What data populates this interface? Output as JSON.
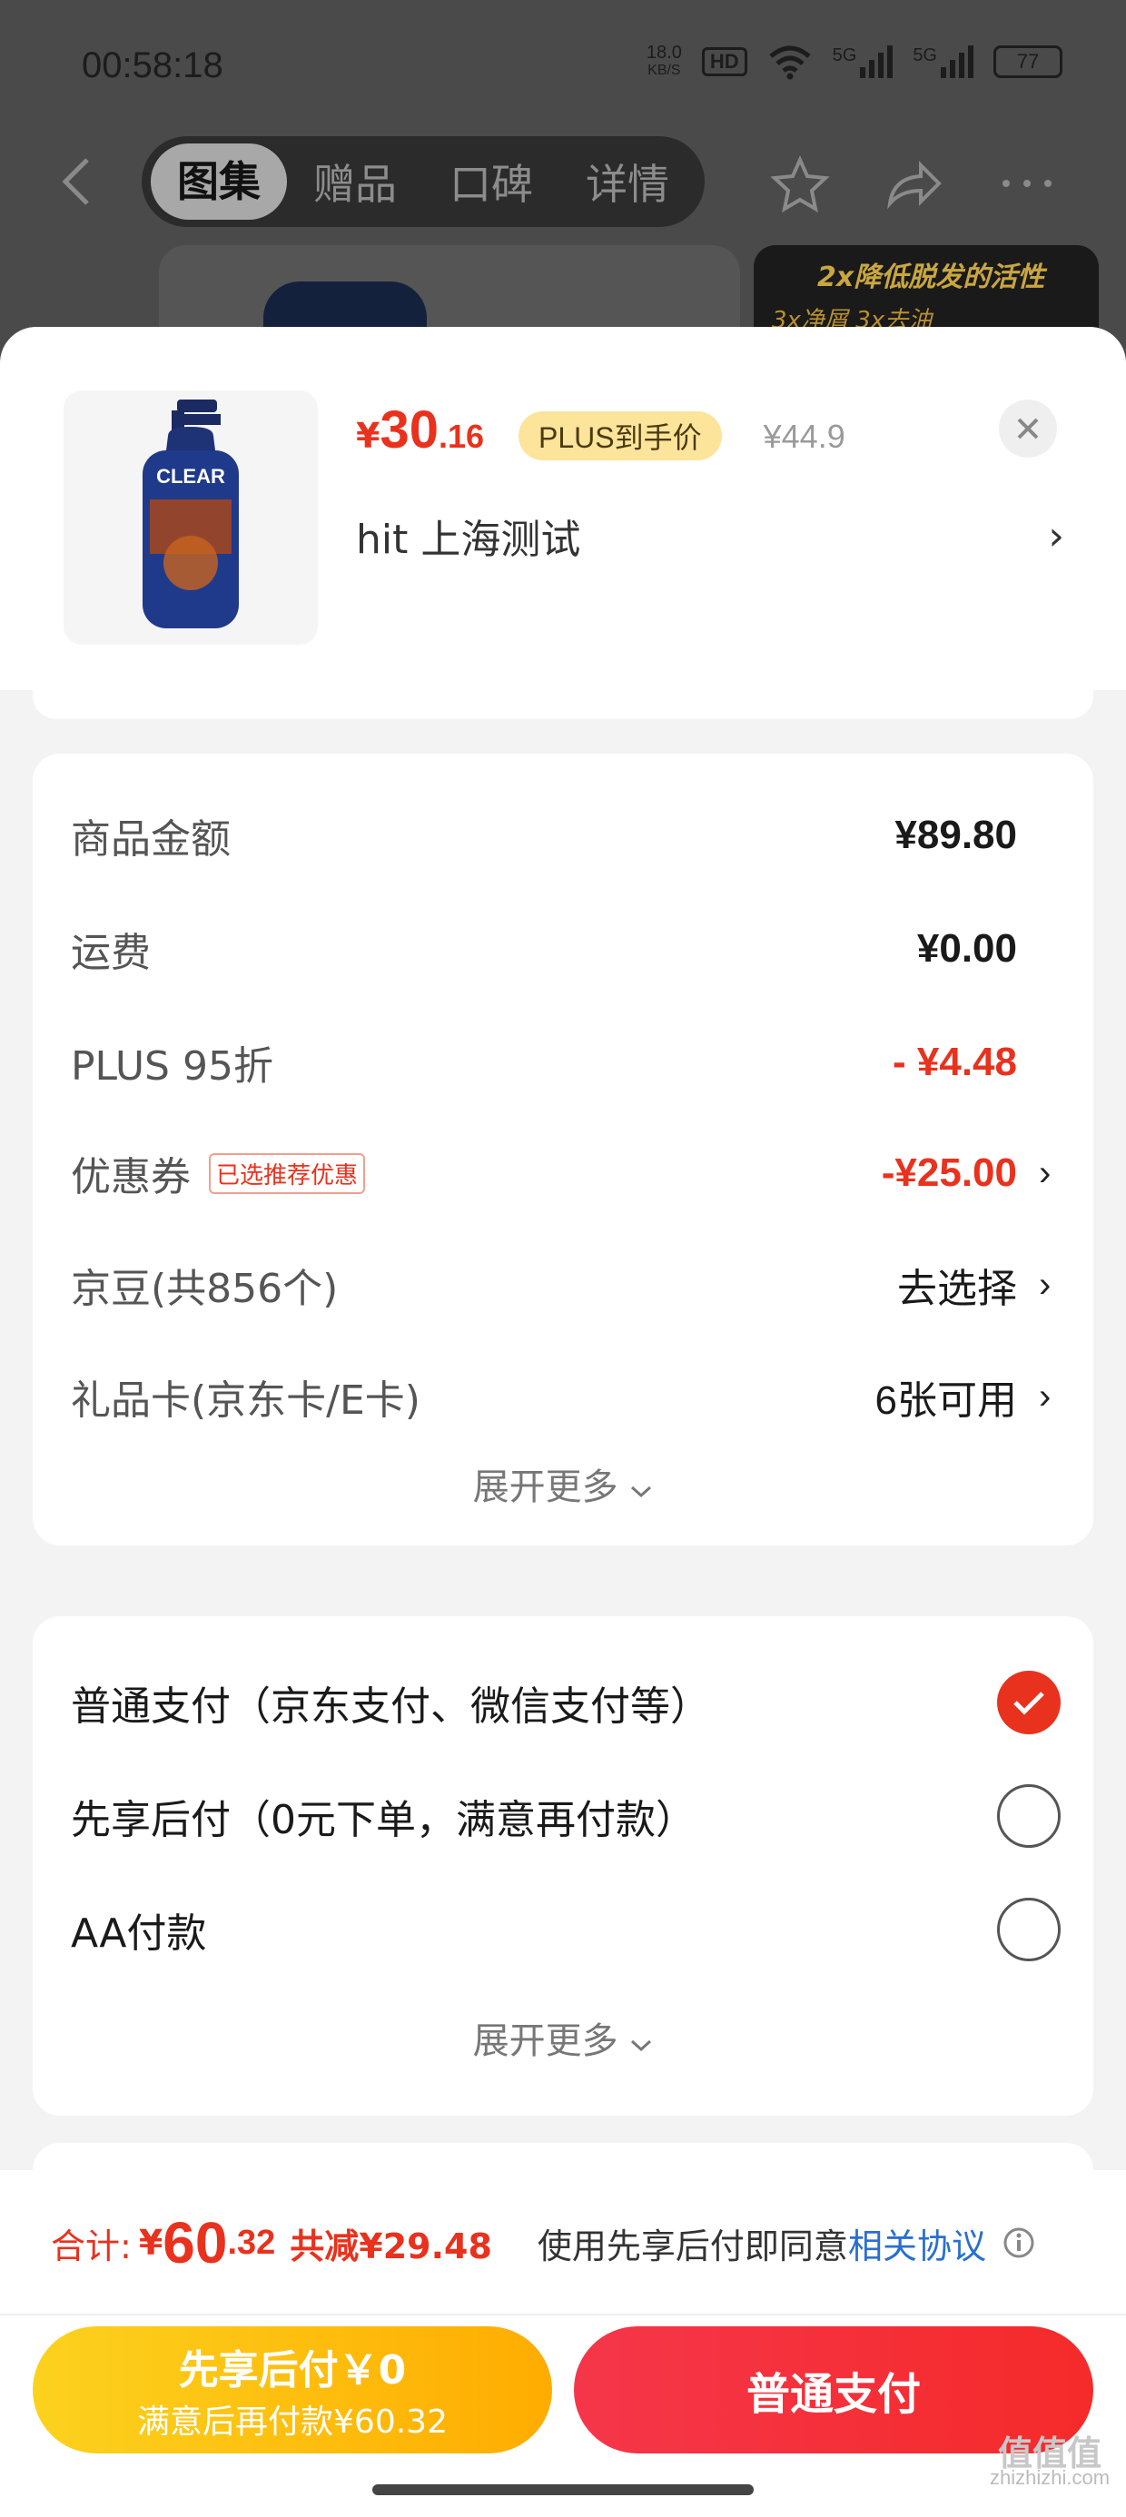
{
  "status_bar": {
    "time": "00:58:18",
    "net_speed_value": "18.0",
    "net_speed_unit": "KB/S",
    "hd_label": "HD",
    "signal1_label": "5G",
    "signal2_label": "5G",
    "battery": "77"
  },
  "nav": {
    "tabs": [
      "图集",
      "赠品",
      "口碑",
      "详情"
    ],
    "active_tab": "图集"
  },
  "background": {
    "banner_line1": "2x降低脱发的活性",
    "banner_line2": "3x净屑 3x去油"
  },
  "product": {
    "price_currency": "¥",
    "price_integer": "30",
    "price_decimal": ".16",
    "plus_tag": "PLUS到手价",
    "original_price": "¥44.9",
    "address": "hit  上海测试",
    "brand_on_thumb": "CLEAR"
  },
  "fees": [
    {
      "label": "商品金额",
      "value": "¥89.80"
    },
    {
      "label": "运费",
      "value": "¥0.00"
    },
    {
      "label": "PLUS 95折",
      "value": "- ¥4.48"
    },
    {
      "label": "优惠券",
      "tag": "已选推荐优惠",
      "value": "-¥25.00"
    },
    {
      "label": "京豆(共856个)",
      "value": "去选择"
    },
    {
      "label": "礼品卡(京东卡/E卡)",
      "value": "6张可用"
    }
  ],
  "expand_more": "展开更多",
  "payment_options": [
    {
      "label": "普通支付（京东支付、微信支付等）",
      "selected": true
    },
    {
      "label": "先享后付（0元下单，满意再付款）",
      "selected": false
    },
    {
      "label": "AA付款",
      "selected": false
    }
  ],
  "bottom": {
    "total_label": "合计:",
    "total_currency": "¥",
    "total_integer": "60",
    "total_decimal": ".32",
    "total_saved": "共减¥29.48",
    "agreement_text": "使用先享后付即同意",
    "agreement_link": "相关协议",
    "btn_later_line1": "先享后付￥0",
    "btn_later_line2": "满意后再付款¥60.32",
    "btn_normal": "普通支付"
  },
  "watermark": {
    "line1": "值值值",
    "line2": "zhizhizhi.com"
  },
  "colors": {
    "accent_red": "#e8321e",
    "plus_gold": "#fce49a",
    "link_blue": "#2a6fcf",
    "later_yellow": "#ffac00"
  }
}
